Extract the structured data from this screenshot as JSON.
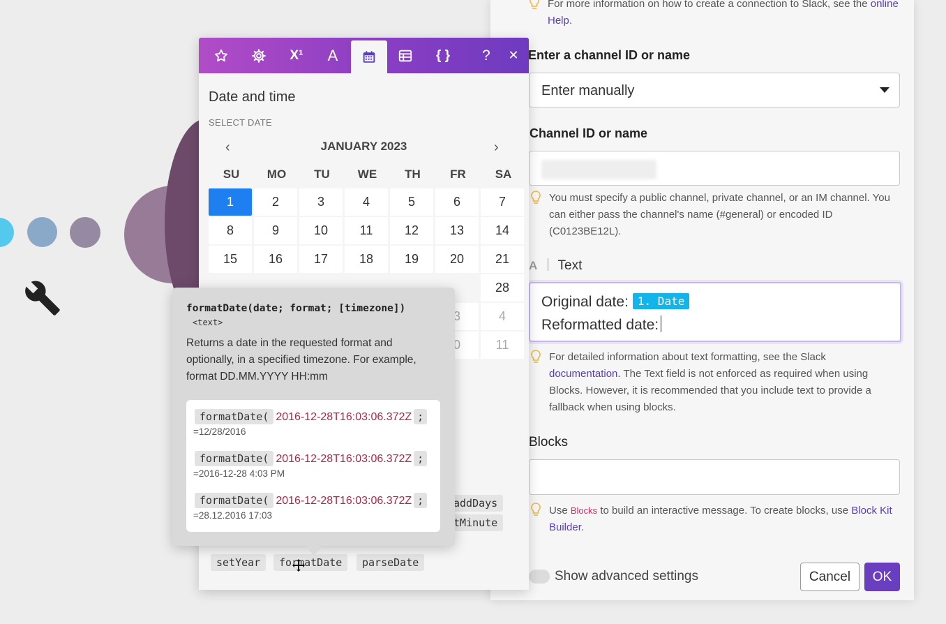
{
  "panel": {
    "top_hint_prefix": "For more information on how to create a connection to Slack, see the",
    "top_hint_link": "online Help",
    "top_hint_suffix": ".",
    "channel_label": "Enter a channel ID or name",
    "channel_mode": "Enter manually",
    "channel_id_label": "Channel ID or name",
    "channel_hint": "You must specify a public channel, private channel, or an IM channel. You can either pass the channel's name (#general) or encoded ID (C0123BE12L).",
    "text_label": "Text",
    "text_icon": "A",
    "text_line1_prefix": "Original date:",
    "text_line1_pill": "1. Date",
    "text_line2": "Reformatted date:",
    "text_hint_prefix": "For detailed information about text formatting, see the Slack",
    "text_hint_link": "documentation",
    "text_hint_suffix": ". The Text field is not enforced as required when using Blocks. However, it is recommended that you include text to provide a fallback when using blocks.",
    "blocks_label": "Blocks",
    "blocks_hint_prefix": "Use",
    "blocks_hint_keyword": "Blocks",
    "blocks_hint_mid": "to build an interactive message. To create blocks, use",
    "blocks_hint_link": "Block Kit Builder",
    "blocks_hint_suffix": ".",
    "advanced_label": "Show advanced settings",
    "cancel_label": "Cancel",
    "ok_label": "OK"
  },
  "popup": {
    "toolbar_icons": [
      "star-icon",
      "gear-icon",
      "superscript-icon",
      "text-icon",
      "calendar-icon",
      "table-icon",
      "braces-icon",
      "help-icon",
      "close-icon"
    ],
    "tb_superscript": "X¹",
    "tb_text": "A",
    "tb_braces": "{ }",
    "tb_help": "?",
    "tb_close": "✕",
    "section_title": "Date and time",
    "select_date_label": "SELECT DATE",
    "month_label": "JANUARY 2023",
    "prev": "‹",
    "next": "›",
    "weekdays": [
      "SU",
      "MO",
      "TU",
      "WE",
      "TH",
      "FR",
      "SA"
    ],
    "days": [
      [
        "1",
        "2",
        "3",
        "4",
        "5",
        "6",
        "7"
      ],
      [
        "8",
        "9",
        "10",
        "11",
        "12",
        "13",
        "14"
      ],
      [
        "15",
        "16",
        "17",
        "18",
        "19",
        "20",
        "21"
      ],
      [
        "",
        "",
        "",
        "",
        "",
        "",
        "28"
      ],
      [
        "",
        "",
        "",
        "",
        "",
        "3",
        "4"
      ],
      [
        "",
        "",
        "",
        "",
        "",
        "0",
        "11"
      ]
    ],
    "selected_day": "1",
    "functions_row1": [
      "addDays"
    ],
    "functions_row2": [
      "tMinute"
    ],
    "functions_row4": [
      "setYear",
      "formatDate",
      "parseDate"
    ]
  },
  "tooltip": {
    "signature": "formatDate(date; format; [timezone])",
    "return_type": "<text>",
    "description": "Returns a date in the requested format and optionally, in a specified timezone. For example, format DD.MM.YYYY HH:mm",
    "examples": [
      {
        "fn": "formatDate(",
        "arg": "2016-12-28T16:03:06.372Z",
        "semi": ";",
        "result": "=12/28/2016"
      },
      {
        "fn": "formatDate(",
        "arg": "2016-12-28T16:03:06.372Z",
        "semi": ";",
        "result": "=2016-12-28 4:03 PM"
      },
      {
        "fn": "formatDate(",
        "arg": "2016-12-28T16:03:06.372Z",
        "semi": ";",
        "result": "=28.12.2016 17:03"
      }
    ]
  },
  "colors": {
    "accent": "#6a3fbf",
    "toolbar_start": "#b14cc6",
    "toolbar_end": "#6e3bbf",
    "selected_day": "#1e7ff0",
    "date_pill": "#12b5ea",
    "example_arg": "#b0254a"
  }
}
